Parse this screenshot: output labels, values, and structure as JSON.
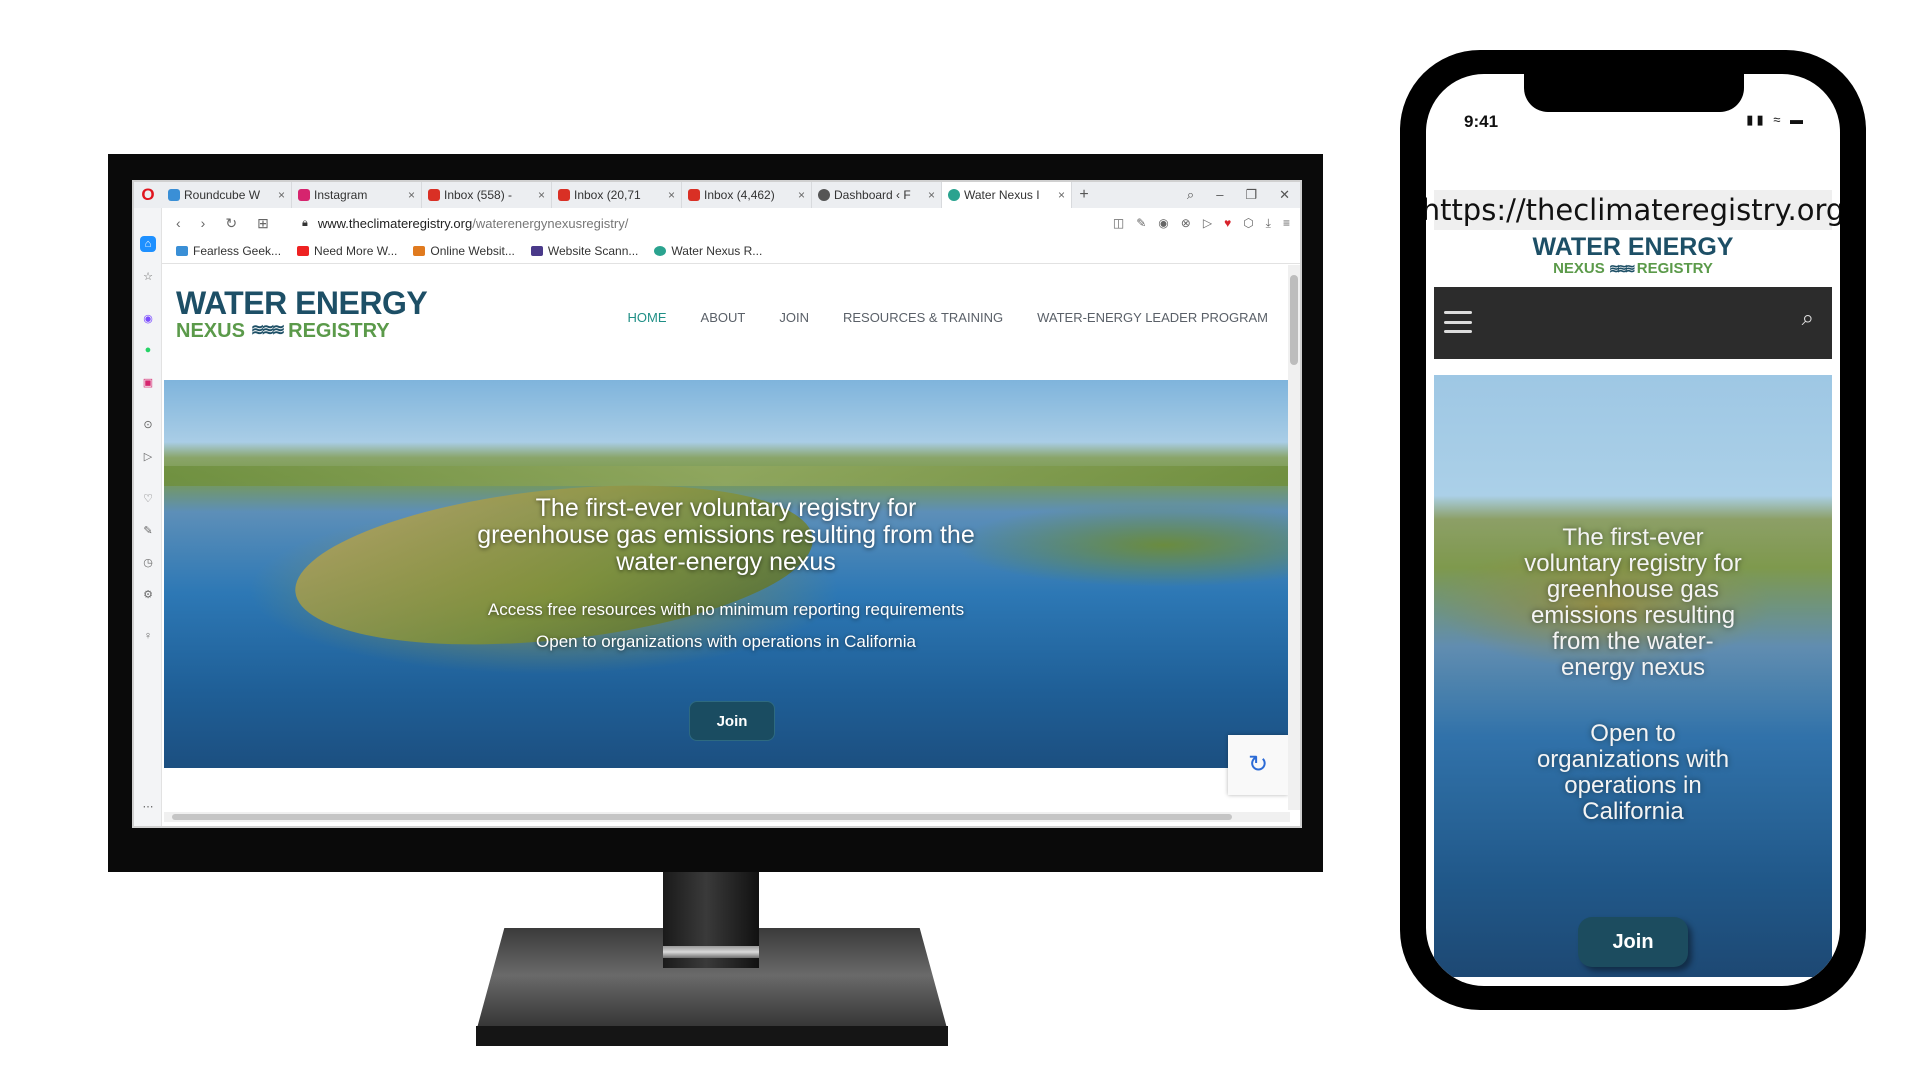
{
  "browser": {
    "tabs": [
      {
        "label": "Roundcube W",
        "color": "#3a8fd6"
      },
      {
        "label": "Instagram",
        "color": "#d6246e"
      },
      {
        "label": "Inbox (558) -",
        "color": "#d93025"
      },
      {
        "label": "Inbox (20,71",
        "color": "#d93025"
      },
      {
        "label": "Inbox (4,462)",
        "color": "#d93025"
      },
      {
        "label": "Dashboard ‹ F",
        "color": "#555555"
      },
      {
        "label": "Water Nexus I",
        "color": "#2aa38f"
      }
    ],
    "url_host": "www.theclimateregistry.org",
    "url_path": "/waterenergynexusregistry/",
    "bookmarks": [
      "Fearless Geek...",
      "Need More W...",
      "Online Websit...",
      "Website Scann...",
      "Water Nexus R..."
    ]
  },
  "site": {
    "logo_line1": "WATER ENERGY",
    "logo_nexus": "NEXUS",
    "logo_registry": "REGISTRY",
    "nav": [
      "HOME",
      "ABOUT",
      "JOIN",
      "RESOURCES & TRAINING",
      "WATER-ENERGY LEADER PROGRAM"
    ],
    "hero_title": "The first-ever voluntary registry for greenhouse gas emissions resulting from the water-energy nexus",
    "hero_sub1": "Access free resources with no minimum reporting requirements",
    "hero_sub2": "Open to organizations with operations in California",
    "join_label": "Join"
  },
  "phone": {
    "time": "9:41",
    "url": "https://theclimateregistry.org",
    "hero_title": "The first-ever voluntary registry for greenhouse gas emissions resulting from the water-energy nexus",
    "hero_sub": "Open to organizations with operations in California",
    "join_label": "Join"
  },
  "colors": {
    "brand_dark": "#1d4f66",
    "brand_green": "#5b9a4a",
    "nav_active": "#1f8f86"
  }
}
